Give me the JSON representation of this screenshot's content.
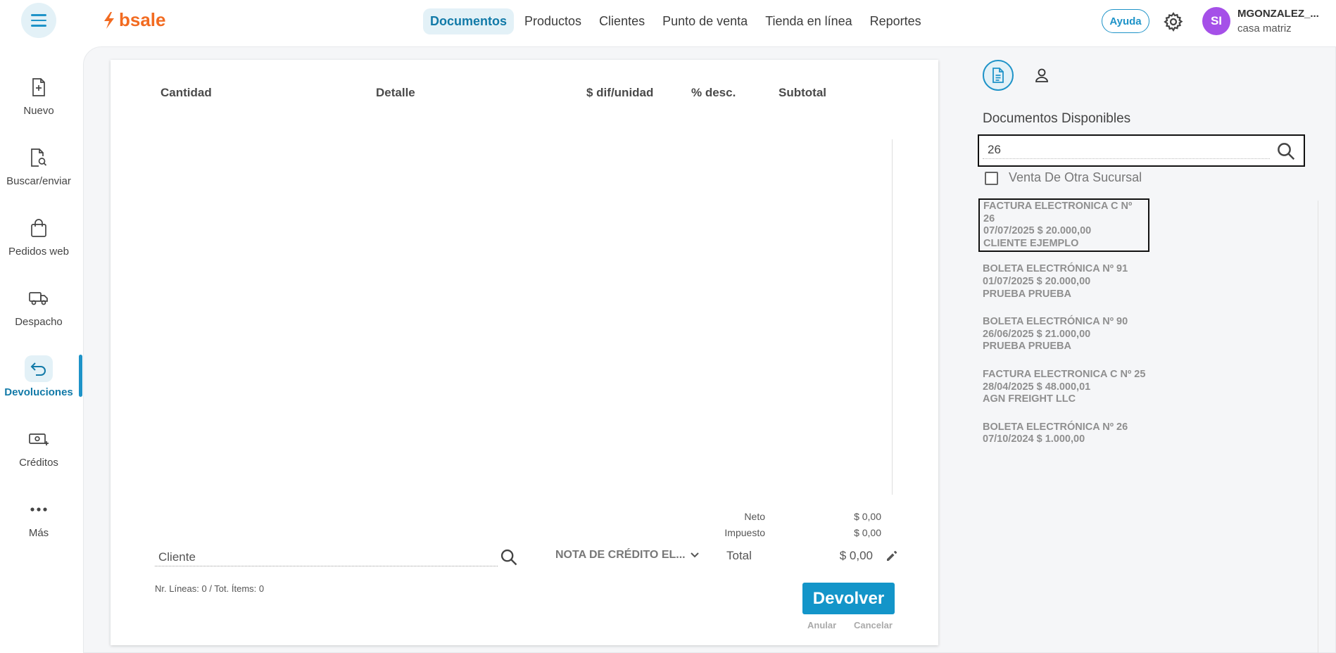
{
  "brand": {
    "name": "bsale",
    "color": "#f26b21"
  },
  "nav": {
    "items": [
      {
        "label": "Documentos",
        "active": true
      },
      {
        "label": "Productos"
      },
      {
        "label": "Clientes"
      },
      {
        "label": "Punto de venta"
      },
      {
        "label": "Tienda en línea"
      },
      {
        "label": "Reportes"
      }
    ]
  },
  "header": {
    "help_label": "Ayuda",
    "avatar_initials": "SI",
    "user_name": "MGONZALEZ_...",
    "user_branch": "casa matriz"
  },
  "sidebar": {
    "items": [
      {
        "label": "Nuevo",
        "icon": "file-plus-icon"
      },
      {
        "label": "Buscar/enviar",
        "icon": "file-search-icon"
      },
      {
        "label": "Pedidos web",
        "icon": "shopping-bag-icon"
      },
      {
        "label": "Despacho",
        "icon": "truck-icon"
      },
      {
        "label": "Devoluciones",
        "icon": "return-arrow-icon",
        "active": true
      },
      {
        "label": "Créditos",
        "icon": "money-plus-icon"
      },
      {
        "label": "Más",
        "icon": "more-dots-icon"
      }
    ]
  },
  "table": {
    "columns": [
      "Cantidad",
      "Detalle",
      "$ dif/unidad",
      "% desc.",
      "Subtotal"
    ]
  },
  "totals": {
    "neto_label": "Neto",
    "neto_value": "$ 0,00",
    "impuesto_label": "Impuesto",
    "impuesto_value": "$ 0,00",
    "total_label": "Total",
    "total_value": "$ 0,00"
  },
  "form": {
    "client_placeholder": "Cliente",
    "doc_type": "NOTA DE CRÉDITO EL...",
    "lines_info": "Nr. Líneas: 0 / Tot. Ítems: 0",
    "devolver_label": "Devolver",
    "anular_label": "Anular",
    "cancelar_label": "Cancelar"
  },
  "right_panel": {
    "title": "Documentos Disponibles",
    "search_value": "26",
    "checkbox_label": "Venta De Otra Sucursal",
    "documents": [
      {
        "line1": "FACTURA ELECTRONICA C Nº 26",
        "line2": "07/07/2025 $ 20.000,00",
        "line3": "CLIENTE EJEMPLO",
        "selected": true
      },
      {
        "line1": "BOLETA ELECTRÓNICA Nº 91",
        "line2": "01/07/2025 $ 20.000,00",
        "line3": "PRUEBA PRUEBA"
      },
      {
        "line1": "BOLETA ELECTRÓNICA Nº 90",
        "line2": "26/06/2025 $ 21.000,00",
        "line3": "PRUEBA PRUEBA"
      },
      {
        "line1": "FACTURA ELECTRONICA C Nº 25",
        "line2": "28/04/2025 $ 48.000,01",
        "line3": "AGN FREIGHT LLC"
      },
      {
        "line1": "BOLETA ELECTRÓNICA Nº 26",
        "line2": "07/10/2024 $ 1.000,00",
        "line3": ""
      }
    ]
  },
  "colors": {
    "accent": "#1e93c8",
    "button": "#1395c9",
    "avatar": "#a550e8"
  }
}
